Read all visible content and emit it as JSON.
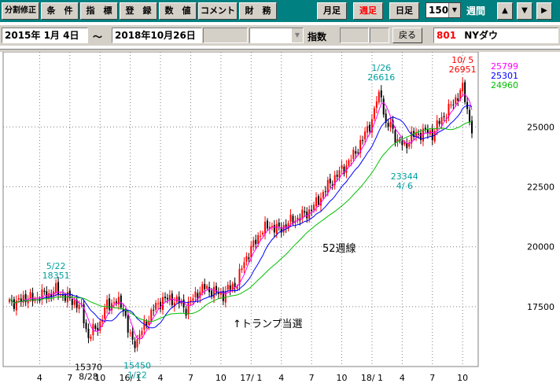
{
  "toolbar": {
    "split_fix_label": "分割修正",
    "buttons": [
      "条　件",
      "指　標",
      "登　録",
      "数　値",
      "コメント",
      "財　務"
    ],
    "period_buttons": [
      {
        "label": "月足",
        "active": false
      },
      {
        "label": "週足",
        "active": true
      },
      {
        "label": "日足",
        "active": false
      }
    ],
    "bar_count": "150",
    "bar_unit": "週間",
    "arrow_up": "▲",
    "arrow_down": "▼",
    "arrow_right": "▶"
  },
  "infobar": {
    "start_date": "2015年  1月  4日",
    "tilde": "〜",
    "end_date": "2018年10月26日",
    "index_label": "指数",
    "back_label": "戻る",
    "code": "801",
    "name": "NYダウ"
  },
  "colors": {
    "teal": "#008080",
    "ma_short": "#ff00ff",
    "ma_mid": "#0000ff",
    "ma_long": "#00c000",
    "up": "#ff0000",
    "down": "#000000",
    "annot_cyan": "#00a0a0",
    "annot_red": "#ff0000",
    "grid": "#808080"
  },
  "chart_data": {
    "type": "candlestick",
    "y_ticks": [
      "25000",
      "22500",
      "20000",
      "17500"
    ],
    "y_tick_values": [
      25000,
      22500,
      20000,
      17500
    ],
    "ylim": [
      15000,
      28000
    ],
    "x_tick_labels": [
      "4",
      "7",
      "10",
      "16/ 1",
      "4",
      "7",
      "10",
      "17/ 1",
      "4",
      "7",
      "10",
      "18/ 1",
      "4",
      "7",
      "10"
    ],
    "x_tick_weeks": [
      13,
      26,
      39,
      52,
      65,
      78,
      91,
      104,
      117,
      130,
      143,
      156,
      169,
      182,
      195
    ],
    "legend_values": [
      {
        "value": "25799",
        "color": "#ff00ff"
      },
      {
        "value": "25301",
        "color": "#0000ff"
      },
      {
        "value": "24960",
        "color": "#00c000"
      }
    ],
    "annotations": [
      {
        "text1": "5/22",
        "text2": "18351",
        "color": "#00a0a0",
        "week": 20,
        "value": 18351,
        "pos": "above"
      },
      {
        "text1": "15370",
        "text2": "8/28",
        "color": "#000000",
        "week": 34,
        "value": 15370,
        "pos": "below"
      },
      {
        "text1": "15450",
        "text2": "1/22",
        "color": "#00a0a0",
        "week": 55,
        "value": 15450,
        "pos": "below"
      },
      {
        "text1": "1/26",
        "text2": "26616",
        "color": "#00a0a0",
        "week": 160,
        "value": 26616,
        "pos": "above"
      },
      {
        "text1": "23344",
        "text2": "4/ 6",
        "color": "#00a0a0",
        "week": 170,
        "value": 23344,
        "pos": "below"
      },
      {
        "text1": "10/ 5",
        "text2": "26951",
        "color": "#ff0000",
        "week": 195,
        "value": 26951,
        "pos": "above"
      }
    ],
    "notes": [
      {
        "text": "52週線"
      },
      {
        "text": "↑トランプ当選"
      }
    ],
    "anchors": [
      [
        0,
        17800
      ],
      [
        3,
        17600
      ],
      [
        6,
        17900
      ],
      [
        10,
        17800
      ],
      [
        14,
        18000
      ],
      [
        17,
        18000
      ],
      [
        20,
        18200
      ],
      [
        24,
        17900
      ],
      [
        28,
        17700
      ],
      [
        31,
        17400
      ],
      [
        34,
        16200
      ],
      [
        36,
        16500
      ],
      [
        39,
        16800
      ],
      [
        42,
        17600
      ],
      [
        46,
        17700
      ],
      [
        49,
        17500
      ],
      [
        51,
        16500
      ],
      [
        53,
        16000
      ],
      [
        55,
        16100
      ],
      [
        58,
        16700
      ],
      [
        62,
        17400
      ],
      [
        66,
        17800
      ],
      [
        70,
        17800
      ],
      [
        73,
        17700
      ],
      [
        76,
        17400
      ],
      [
        80,
        18000
      ],
      [
        84,
        18300
      ],
      [
        88,
        18100
      ],
      [
        92,
        18000
      ],
      [
        95,
        18300
      ],
      [
        98,
        18500
      ],
      [
        101,
        19400
      ],
      [
        104,
        19900
      ],
      [
        108,
        20600
      ],
      [
        112,
        20900
      ],
      [
        116,
        20700
      ],
      [
        120,
        21000
      ],
      [
        124,
        21200
      ],
      [
        128,
        21400
      ],
      [
        132,
        21800
      ],
      [
        136,
        22400
      ],
      [
        140,
        22900
      ],
      [
        144,
        23300
      ],
      [
        148,
        23800
      ],
      [
        152,
        24500
      ],
      [
        156,
        25300
      ],
      [
        158,
        26100
      ],
      [
        160,
        26400
      ],
      [
        162,
        25000
      ],
      [
        164,
        25100
      ],
      [
        167,
        24400
      ],
      [
        170,
        24200
      ],
      [
        173,
        24600
      ],
      [
        176,
        24700
      ],
      [
        179,
        24800
      ],
      [
        182,
        24700
      ],
      [
        185,
        25200
      ],
      [
        188,
        25600
      ],
      [
        191,
        26000
      ],
      [
        194,
        26500
      ],
      [
        195,
        26600
      ],
      [
        197,
        25700
      ],
      [
        199,
        24900
      ]
    ]
  }
}
